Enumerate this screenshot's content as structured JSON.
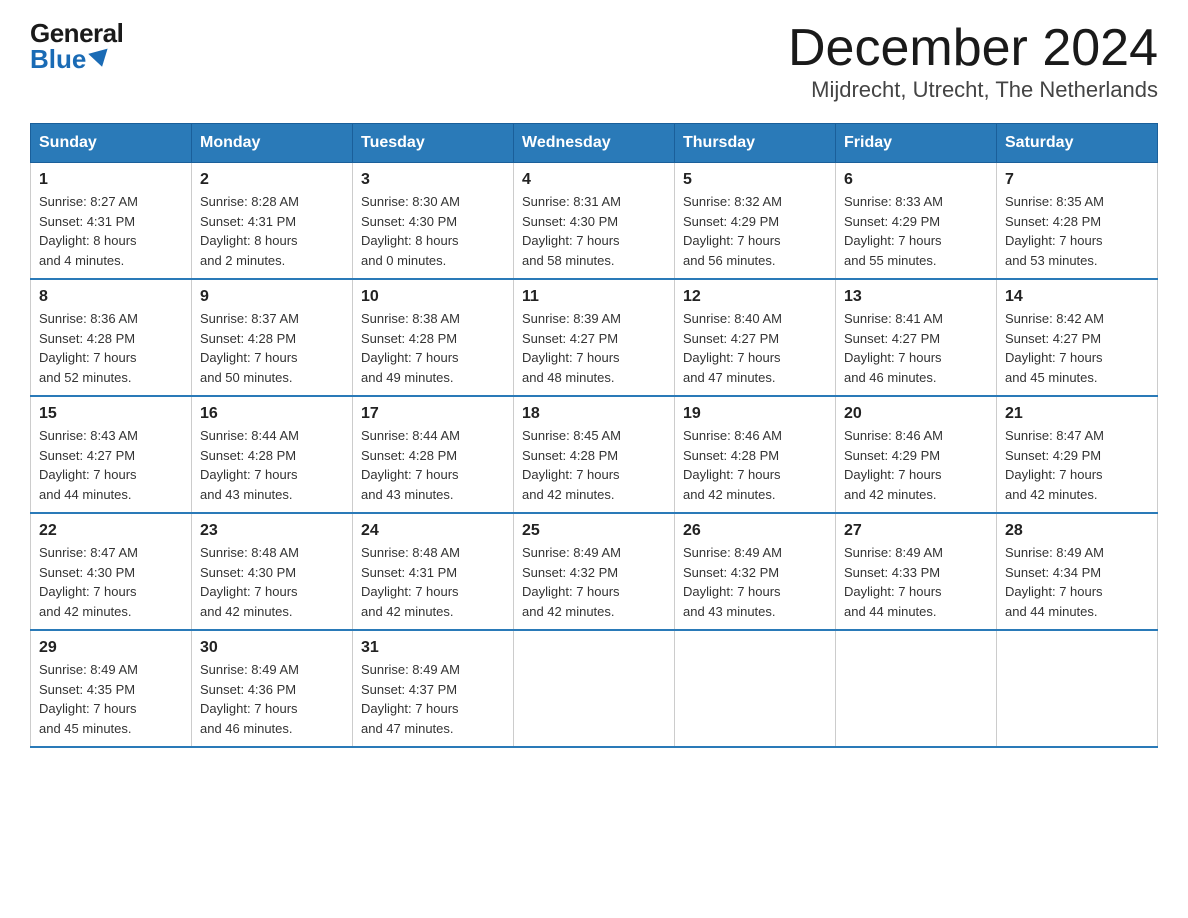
{
  "logo": {
    "general": "General",
    "blue": "Blue"
  },
  "header": {
    "month": "December 2024",
    "location": "Mijdrecht, Utrecht, The Netherlands"
  },
  "days_of_week": [
    "Sunday",
    "Monday",
    "Tuesday",
    "Wednesday",
    "Thursday",
    "Friday",
    "Saturday"
  ],
  "weeks": [
    [
      {
        "day": "1",
        "info": "Sunrise: 8:27 AM\nSunset: 4:31 PM\nDaylight: 8 hours\nand 4 minutes."
      },
      {
        "day": "2",
        "info": "Sunrise: 8:28 AM\nSunset: 4:31 PM\nDaylight: 8 hours\nand 2 minutes."
      },
      {
        "day": "3",
        "info": "Sunrise: 8:30 AM\nSunset: 4:30 PM\nDaylight: 8 hours\nand 0 minutes."
      },
      {
        "day": "4",
        "info": "Sunrise: 8:31 AM\nSunset: 4:30 PM\nDaylight: 7 hours\nand 58 minutes."
      },
      {
        "day": "5",
        "info": "Sunrise: 8:32 AM\nSunset: 4:29 PM\nDaylight: 7 hours\nand 56 minutes."
      },
      {
        "day": "6",
        "info": "Sunrise: 8:33 AM\nSunset: 4:29 PM\nDaylight: 7 hours\nand 55 minutes."
      },
      {
        "day": "7",
        "info": "Sunrise: 8:35 AM\nSunset: 4:28 PM\nDaylight: 7 hours\nand 53 minutes."
      }
    ],
    [
      {
        "day": "8",
        "info": "Sunrise: 8:36 AM\nSunset: 4:28 PM\nDaylight: 7 hours\nand 52 minutes."
      },
      {
        "day": "9",
        "info": "Sunrise: 8:37 AM\nSunset: 4:28 PM\nDaylight: 7 hours\nand 50 minutes."
      },
      {
        "day": "10",
        "info": "Sunrise: 8:38 AM\nSunset: 4:28 PM\nDaylight: 7 hours\nand 49 minutes."
      },
      {
        "day": "11",
        "info": "Sunrise: 8:39 AM\nSunset: 4:27 PM\nDaylight: 7 hours\nand 48 minutes."
      },
      {
        "day": "12",
        "info": "Sunrise: 8:40 AM\nSunset: 4:27 PM\nDaylight: 7 hours\nand 47 minutes."
      },
      {
        "day": "13",
        "info": "Sunrise: 8:41 AM\nSunset: 4:27 PM\nDaylight: 7 hours\nand 46 minutes."
      },
      {
        "day": "14",
        "info": "Sunrise: 8:42 AM\nSunset: 4:27 PM\nDaylight: 7 hours\nand 45 minutes."
      }
    ],
    [
      {
        "day": "15",
        "info": "Sunrise: 8:43 AM\nSunset: 4:27 PM\nDaylight: 7 hours\nand 44 minutes."
      },
      {
        "day": "16",
        "info": "Sunrise: 8:44 AM\nSunset: 4:28 PM\nDaylight: 7 hours\nand 43 minutes."
      },
      {
        "day": "17",
        "info": "Sunrise: 8:44 AM\nSunset: 4:28 PM\nDaylight: 7 hours\nand 43 minutes."
      },
      {
        "day": "18",
        "info": "Sunrise: 8:45 AM\nSunset: 4:28 PM\nDaylight: 7 hours\nand 42 minutes."
      },
      {
        "day": "19",
        "info": "Sunrise: 8:46 AM\nSunset: 4:28 PM\nDaylight: 7 hours\nand 42 minutes."
      },
      {
        "day": "20",
        "info": "Sunrise: 8:46 AM\nSunset: 4:29 PM\nDaylight: 7 hours\nand 42 minutes."
      },
      {
        "day": "21",
        "info": "Sunrise: 8:47 AM\nSunset: 4:29 PM\nDaylight: 7 hours\nand 42 minutes."
      }
    ],
    [
      {
        "day": "22",
        "info": "Sunrise: 8:47 AM\nSunset: 4:30 PM\nDaylight: 7 hours\nand 42 minutes."
      },
      {
        "day": "23",
        "info": "Sunrise: 8:48 AM\nSunset: 4:30 PM\nDaylight: 7 hours\nand 42 minutes."
      },
      {
        "day": "24",
        "info": "Sunrise: 8:48 AM\nSunset: 4:31 PM\nDaylight: 7 hours\nand 42 minutes."
      },
      {
        "day": "25",
        "info": "Sunrise: 8:49 AM\nSunset: 4:32 PM\nDaylight: 7 hours\nand 42 minutes."
      },
      {
        "day": "26",
        "info": "Sunrise: 8:49 AM\nSunset: 4:32 PM\nDaylight: 7 hours\nand 43 minutes."
      },
      {
        "day": "27",
        "info": "Sunrise: 8:49 AM\nSunset: 4:33 PM\nDaylight: 7 hours\nand 44 minutes."
      },
      {
        "day": "28",
        "info": "Sunrise: 8:49 AM\nSunset: 4:34 PM\nDaylight: 7 hours\nand 44 minutes."
      }
    ],
    [
      {
        "day": "29",
        "info": "Sunrise: 8:49 AM\nSunset: 4:35 PM\nDaylight: 7 hours\nand 45 minutes."
      },
      {
        "day": "30",
        "info": "Sunrise: 8:49 AM\nSunset: 4:36 PM\nDaylight: 7 hours\nand 46 minutes."
      },
      {
        "day": "31",
        "info": "Sunrise: 8:49 AM\nSunset: 4:37 PM\nDaylight: 7 hours\nand 47 minutes."
      },
      null,
      null,
      null,
      null
    ]
  ]
}
